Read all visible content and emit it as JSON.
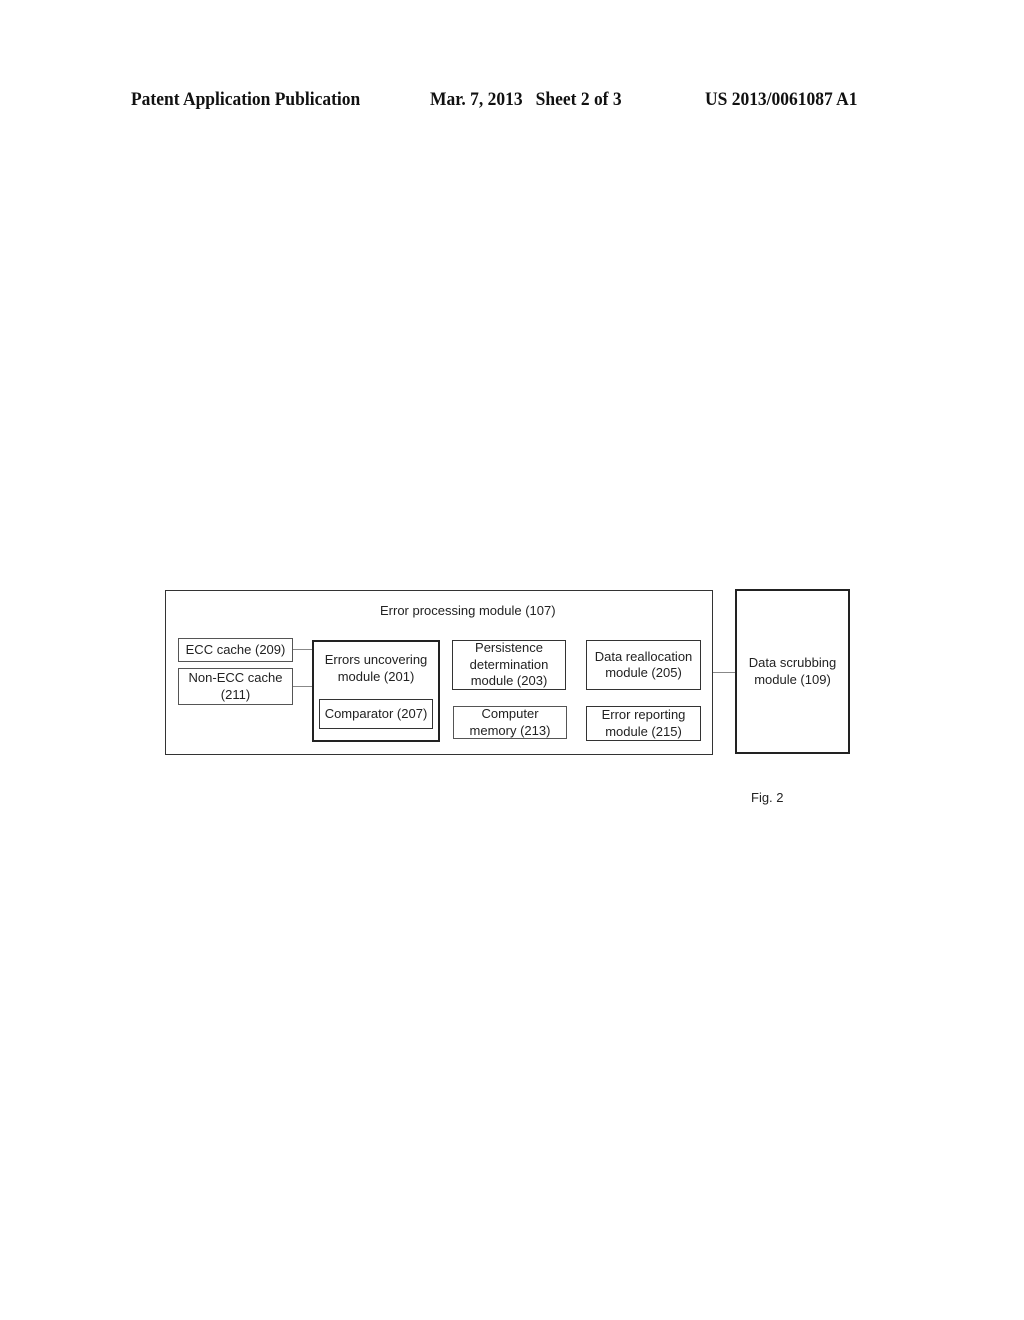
{
  "header": {
    "left": "Patent Application Publication",
    "middle": "Mar. 7, 2013   Sheet 2 of 3",
    "right": "US 2013/0061087 A1"
  },
  "diagram": {
    "outer": {
      "label": "Error processing module (107)"
    },
    "ecc_cache": "ECC cache (209)",
    "non_ecc_cache": "Non-ECC cache (211)",
    "errors_uncovering": "Errors uncovering module (201)",
    "comparator": "Comparator (207)",
    "persistence": "Persistence determination module (203)",
    "computer_memory": "Computer memory (213)",
    "data_reallocation": "Data reallocation module (205)",
    "error_reporting": "Error reporting module (215)",
    "data_scrubbing": "Data scrubbing module (109)"
  },
  "figure_label": "Fig. 2"
}
